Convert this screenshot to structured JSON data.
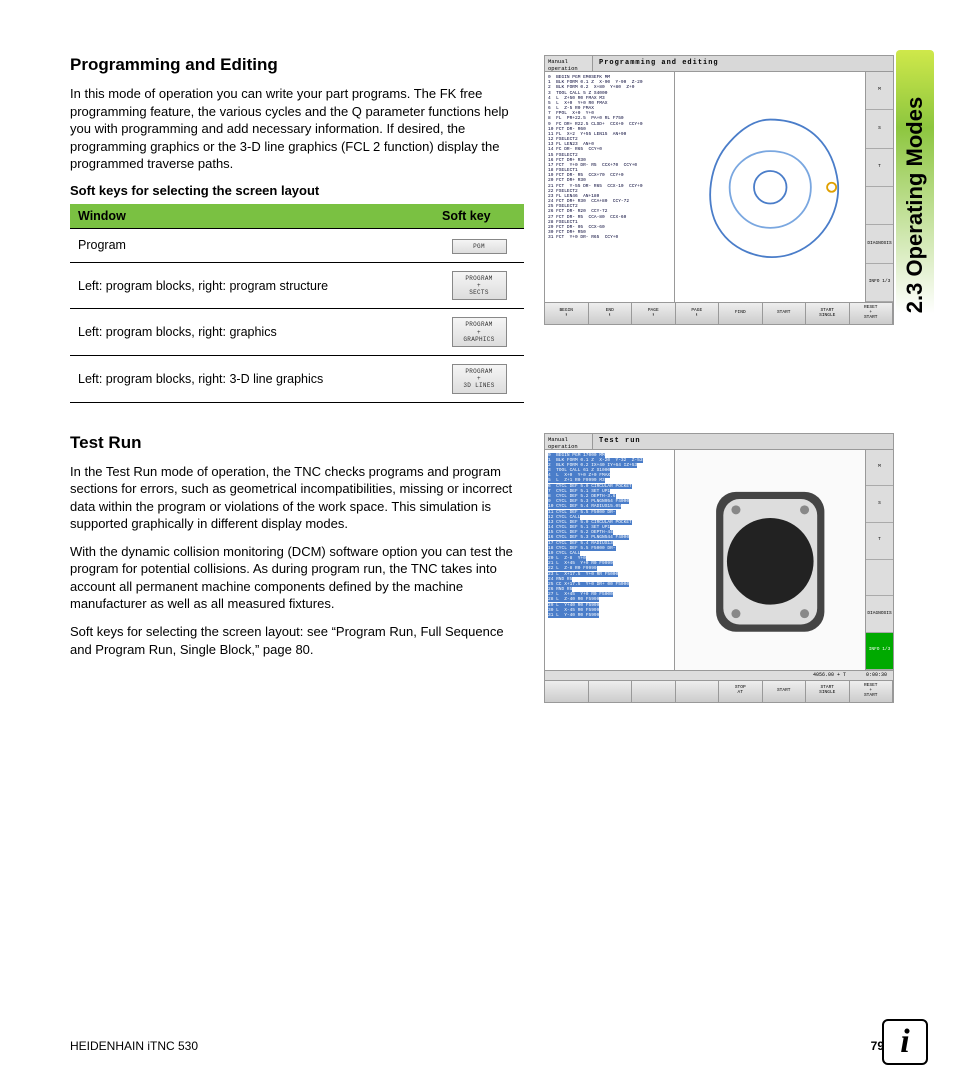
{
  "sideTab": "2.3 Operating Modes",
  "section1": {
    "title": "Programming and Editing",
    "p1": "In this mode of operation you can write your part programs. The FK free programming feature, the various cycles and the Q parameter functions help you with programming and add necessary information. If desired, the programming graphics or the 3-D line graphics (FCL 2 function) display the programmed traverse paths.",
    "subhead": "Soft keys for selecting the screen layout",
    "table": {
      "h1": "Window",
      "h2": "Soft key",
      "rows": [
        {
          "w": "Program",
          "k": "PGM"
        },
        {
          "w": "Left: program blocks, right: program structure",
          "k": "PROGRAM\n+\nSECTS"
        },
        {
          "w": "Left: program blocks, right: graphics",
          "k": "PROGRAM\n+\nGRAPHICS"
        },
        {
          "w": "Left: program blocks, right: 3-D line graphics",
          "k": "PROGRAM\n+\n3D LINES"
        }
      ]
    }
  },
  "section2": {
    "title": "Test Run",
    "p1": "In the Test Run mode of operation, the TNC checks programs and program sections for errors, such as geometrical incompatibilities, missing or incorrect data within the program or violations of the work space. This simulation is supported graphically in different display modes.",
    "p2": "With the dynamic collision monitoring (DCM) software option you can test the program for potential collisions. As during program run, the TNC takes into account all permanent machine components defined by the machine manufacturer as well as all measured fixtures.",
    "p3": "Soft keys for selecting the screen layout: see “Program Run, Full Sequence and Program Run, Single Block,” page 80."
  },
  "screenshot1": {
    "mode": "Manual operation",
    "title": "Programming and editing",
    "code": "0  BEGIN PGM EM0SEFK MM\n1  BLK FORM 0.1 Z  X-90  Y-90  Z-20\n2  BLK FORM 0.2  X+80  Y+80  Z+0\n3  TOOL CALL 5 Z S4000\n4  L  Z+50 R0 FMAX M3\n5  L  X+0  Y+0 R0 FMAX\n6  L  Z-5 R0 FMAX\n7  FPOL  X+0  Y+0\n8  FL  PR+22.5  PA+0 RL F750\n9  FC DR+ R22.5 CLSD+  CCX+0  CCY+0\n10 FCT DR- R60\n11 FL  X+2  Y+55 LEN15  AN+90\n12 FSELECT2\n13 FL LEN23  AN+0\n14 FC DR- R65  CCY+0\n15 FSELECT2\n16 FCT DR+ R30\n17 FCT  Y+0 DR- R5  CCX+70  CCY+0\n18 FSELECT1\n19 FCT DR- R5  CCX+70  CCY+0\n20 FCT DR+ R30\n21 FCT  Y-55 DR- R65  CCX-10  CCY+0\n22 FSELECT2\n23 FL LEN46  AN+180\n24 FCT DR+ R30  CCA+80  CCY-72\n25 FSELECT2\n26 FCT DR- R20  CCY-72\n27 FCT DR- R5  CCA-80  CCX-60\n28 FSELECT1\n29 FCT DR- 05  CCX-60\n30 FCT DR+ R50\n31 FCT  Y+0 DR- R65  CCY+0",
    "rightButtons": [
      "M",
      "S",
      "T",
      "",
      "DIAGNOSIS",
      "INFO 1/3"
    ],
    "softkeys": [
      "BEGIN\n⬆",
      "END\n⬇",
      "PAGE\n⬆",
      "PAGE\n⬇",
      "FIND",
      "START",
      "START\nSINGLE",
      "RESET\n+\nSTART"
    ]
  },
  "screenshot2": {
    "mode": "Manual operation",
    "title": "Test run",
    "code": "0  BEGIN PGM 17000 MM\n1  BLK FORM 0.1 Z  X-20  Y-32  Z-53\n2  BLK FORM 0.2 IX+40 IY+64 IZ+53\n3  TOOL CALL 61 Z S1000\n4  L  X+0  Y+0 Z+0 FMAX\n5  L  Z+1 R0 F9999 M3\n6  CYCL DEF 5.0 CIRCULAR POCKET\n7  CYCL DEF 5.1 SET UP1\n8  CYCL DEF 5.2 DEPTH-3.6\n9  CYCL DEF 5.3 PLNGN954 F4000\n10 CYCL DEF 5.4 RADIUS15.05\n11 CYCL DEF 5.5 F5000 DR-\n12 CYCL CALL\n13 CYCL DEF 5.0 CIRCULAR POCKET\n14 CYCL DEF 5.1 SET UP1\n15 CYCL DEF 5.2 DEPTH-44\n16 CYCL DEF 5.3 PLNGN544 F4000\n17 CYCL DEF 5.4 RADIUS13\n18 CYCL DEF 5.5 F5000 DR-\n19 CYCL CALL\n20 L  Z-8  Y+0\n21 L  X+45  Y+0 R0 F9999\n22 L  Z-8 R0 F9999\n23 L  X+17.5  Y+0 RR F5000\n24 RND R5\n25 CC X+17.5  Y+0 DR+ 00 F5000\n26 RND R5\n27 L  X+45  Y+0 R0 F5000\n28 L  Z-40 R0 F5999\n29 L  Y+40 R0 F5999\n30 L  X-45 R0 F5999\n31 L  Y-40 R0 F5999",
    "status": {
      "left": "4056.00 + T",
      "right": "0:00:30"
    },
    "rightButtons": [
      "M",
      "S",
      "T",
      "",
      "DIAGNOSIS",
      "INFO 1/3"
    ],
    "softkeys": [
      "",
      "",
      "",
      "",
      "STOP\nAT",
      "START",
      "START\nSINGLE",
      "RESET\n+\nSTART"
    ]
  },
  "footer": {
    "left": "HEIDENHAIN iTNC 530",
    "page": "79"
  },
  "infoIcon": "i"
}
